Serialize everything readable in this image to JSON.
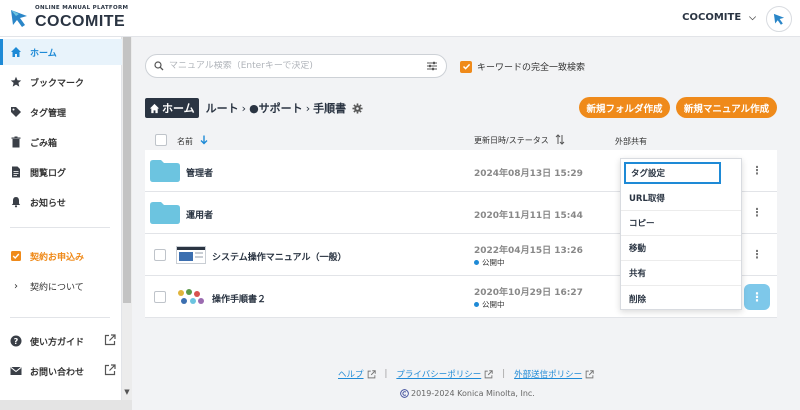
{
  "header": {
    "brand_sub": "ONLINE MANUAL PLATFORM",
    "brand": "COCOMITE",
    "user_name": "COCOMITE"
  },
  "sidebar": {
    "items": [
      {
        "label": "ホーム",
        "icon": "home-icon"
      },
      {
        "label": "ブックマーク",
        "icon": "star-icon"
      },
      {
        "label": "タグ管理",
        "icon": "tag-icon"
      },
      {
        "label": "ごみ箱",
        "icon": "trash-icon"
      },
      {
        "label": "閲覧ログ",
        "icon": "log-icon"
      },
      {
        "label": "お知らせ",
        "icon": "bell-icon"
      },
      {
        "label": "契約お申込み",
        "icon": "checkbox-icon"
      },
      {
        "label": "契約について",
        "icon": "chevron-right-icon"
      },
      {
        "label": "使い方ガイド",
        "icon": "help-icon"
      },
      {
        "label": "お問い合わせ",
        "icon": "mail-icon"
      }
    ]
  },
  "search": {
    "placeholder": "マニュアル検索（Enterキーで決定)",
    "value": "",
    "exact_match_label": "キーワードの完全一致検索",
    "exact_match_checked": true
  },
  "breadcrumb": {
    "home": "ホーム",
    "path": [
      "ルート",
      "●サポート",
      "手順書"
    ]
  },
  "actions": {
    "new_folder": "新規フォルダ作成",
    "new_manual": "新規マニュアル作成"
  },
  "table": {
    "headers": {
      "name": "名前",
      "updated": "更新日時/ステータス",
      "share": "外部共有"
    },
    "rows": [
      {
        "type": "folder",
        "name": "管理者",
        "updated": "2024年08月13日 15:29",
        "status": ""
      },
      {
        "type": "folder",
        "name": "運用者",
        "updated": "2020年11月11日 15:44",
        "status": ""
      },
      {
        "type": "manual",
        "name": "システム操作マニュアル（一般）",
        "updated": "2022年04月15日 13:26",
        "status": "公開中"
      },
      {
        "type": "manual",
        "name": "操作手順書２",
        "updated": "2020年10月29日 16:27",
        "status": "公開中"
      }
    ]
  },
  "context_menu": {
    "items": [
      "タグ設定",
      "URL取得",
      "コピー",
      "移動",
      "共有",
      "削除"
    ]
  },
  "footer": {
    "links": [
      "ヘルプ",
      "プライバシーポリシー",
      "外部送信ポリシー"
    ],
    "copyright": "2019-2024 Konica Minolta, Inc."
  },
  "colors": {
    "accent": "#1e8ad6",
    "orange": "#ef8a1a",
    "navy": "#2a3442",
    "folder": "#6cc4e0"
  }
}
